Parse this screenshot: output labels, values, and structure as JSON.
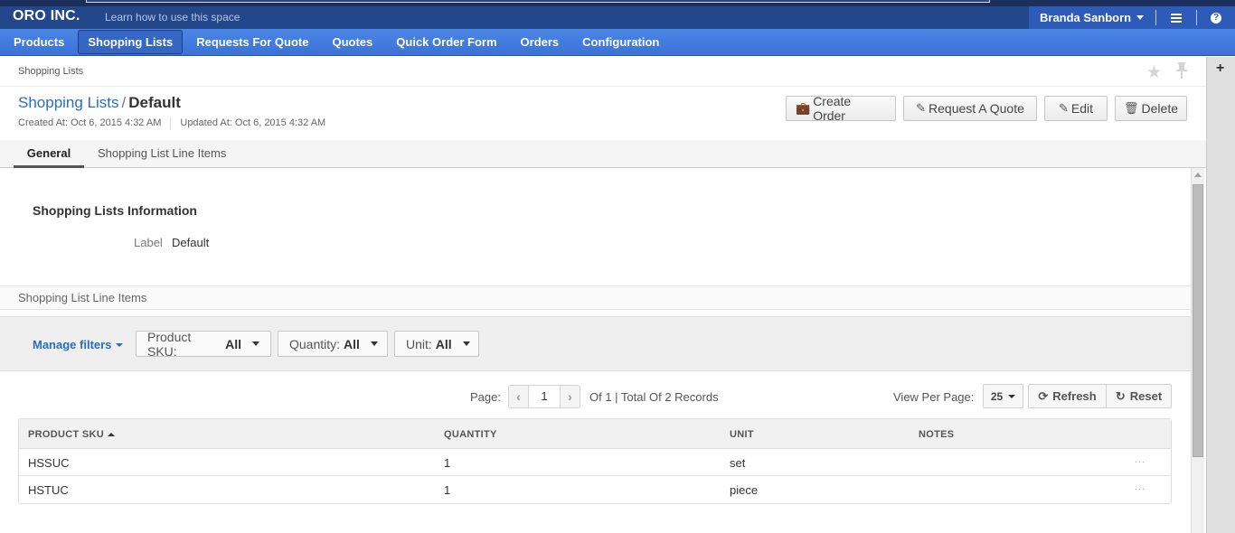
{
  "app": {
    "logo": "ORO INC.",
    "learn_link": "Learn how to use this space",
    "user_name": "Branda Sanborn",
    "help_glyph": "?"
  },
  "nav": {
    "items": [
      {
        "label": "Products",
        "active": false
      },
      {
        "label": "Shopping Lists",
        "active": true
      },
      {
        "label": "Requests For Quote",
        "active": false
      },
      {
        "label": "Quotes",
        "active": false
      },
      {
        "label": "Quick Order Form",
        "active": false
      },
      {
        "label": "Orders",
        "active": false
      },
      {
        "label": "Configuration",
        "active": false
      }
    ]
  },
  "breadcrumb": "Shopping Lists",
  "page": {
    "title_link": "Shopping Lists",
    "title_sep": "/",
    "title_current": "Default",
    "created_at": "Created At: Oct 6, 2015 4:32 AM",
    "updated_at": "Updated At: Oct 6, 2015 4:32 AM"
  },
  "actions": {
    "create_order": "Create Order",
    "request_quote": "Request A Quote",
    "edit": "Edit",
    "delete": "Delete"
  },
  "tabs": [
    {
      "label": "General",
      "active": true
    },
    {
      "label": "Shopping List Line Items",
      "active": false
    }
  ],
  "info": {
    "section_title": "Shopping Lists Information",
    "label_name": "Label",
    "label_value": "Default"
  },
  "line_items": {
    "section_title": "Shopping List Line Items",
    "manage_filters": "Manage filters",
    "filters": [
      {
        "name": "Product SKU:",
        "value": "All"
      },
      {
        "name": "Quantity:",
        "value": "All"
      },
      {
        "name": "Unit:",
        "value": "All"
      }
    ],
    "pager": {
      "label": "Page:",
      "current": "1",
      "total_text": "Of 1 | Total Of 2 Records"
    },
    "view_per_page_label": "View Per Page:",
    "view_per_page_value": "25",
    "refresh": "Refresh",
    "reset": "Reset",
    "columns": [
      "PRODUCT SKU",
      "QUANTITY",
      "UNIT",
      "NOTES"
    ],
    "rows": [
      {
        "sku": "HSSUC",
        "quantity": "1",
        "unit": "set",
        "notes": "",
        "actions": "..."
      },
      {
        "sku": "HSTUC",
        "quantity": "1",
        "unit": "piece",
        "notes": "",
        "actions": "..."
      }
    ]
  },
  "colors": {
    "header_bg": "#23478b",
    "nav_bg": "#4a86e6",
    "link": "#2a6ebb"
  }
}
